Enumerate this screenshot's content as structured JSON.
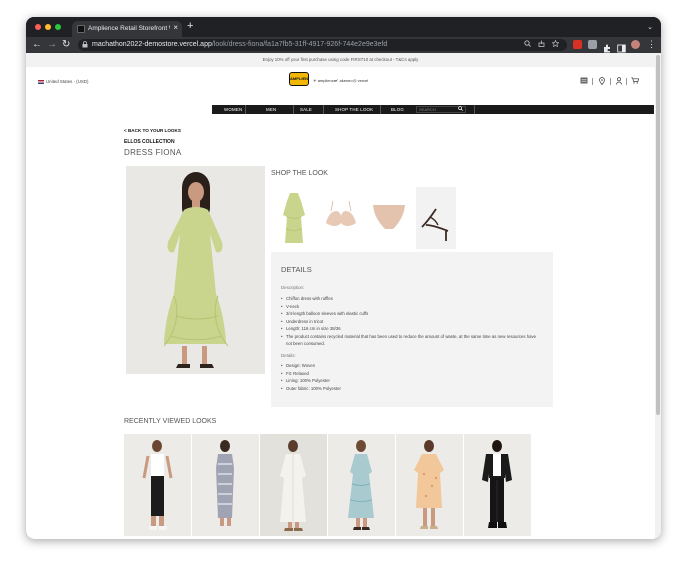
{
  "browser": {
    "tab_title": "Amplience Retail Storefront W",
    "tab_close": "×",
    "new_tab": "+",
    "tab_menu": "⌄",
    "url_host": "machathon2022-demostore.vercel.app",
    "url_path": "/look/dress-fiona/fa1a7fb5-31ff-4917-926f-744e2e9e3efd",
    "back": "←",
    "forward": "→",
    "reload": "↻",
    "lock": "🔒",
    "menu": "⋮"
  },
  "site": {
    "promo": "Enjoy 10% off your first purchase using code FIRST10 at checkout - T&Cs apply",
    "country": "United States · (USD)",
    "logo_text": "AMPLIENCE",
    "partner_logos": [
      "☀ amplience",
      "✔ akeneo",
      "◎ vercel"
    ],
    "nav": [
      "WOMEN",
      "MEN",
      "SALE",
      "SHOP THE LOOK",
      "BLOG"
    ],
    "search_placeholder": "SEARCH"
  },
  "page": {
    "back_link": "< BACK TO YOUR LOOKS",
    "collection": "ELLOS COLLECTION",
    "title": "DRESS FIONA",
    "shop_title": "SHOP THE LOOK",
    "details_title": "DETAILS",
    "description_label": "Description:",
    "description": [
      "Chiffon dress with ruffles",
      "V-neck",
      "3/4-length balloon sleeves with elastic cuffs",
      "Underdress in tricot",
      "Length: 116 cm in size 38/36",
      "The product contains recycled material that has been used to reduce the amount of waste, at the same time as new resources have not been consumed."
    ],
    "details_label": "Details:",
    "details": [
      "Design: Woven",
      "Fit: Relaxed",
      "Lining: 100% Polyester",
      "Outer fabric: 100% Polyester"
    ],
    "recent_title": "RECENTLY VIEWED LOOKS"
  },
  "colors": {
    "accent_dark": "#1a1a1a",
    "dress_green": "#c9d58c",
    "panel_grey": "#f3f3f3"
  }
}
